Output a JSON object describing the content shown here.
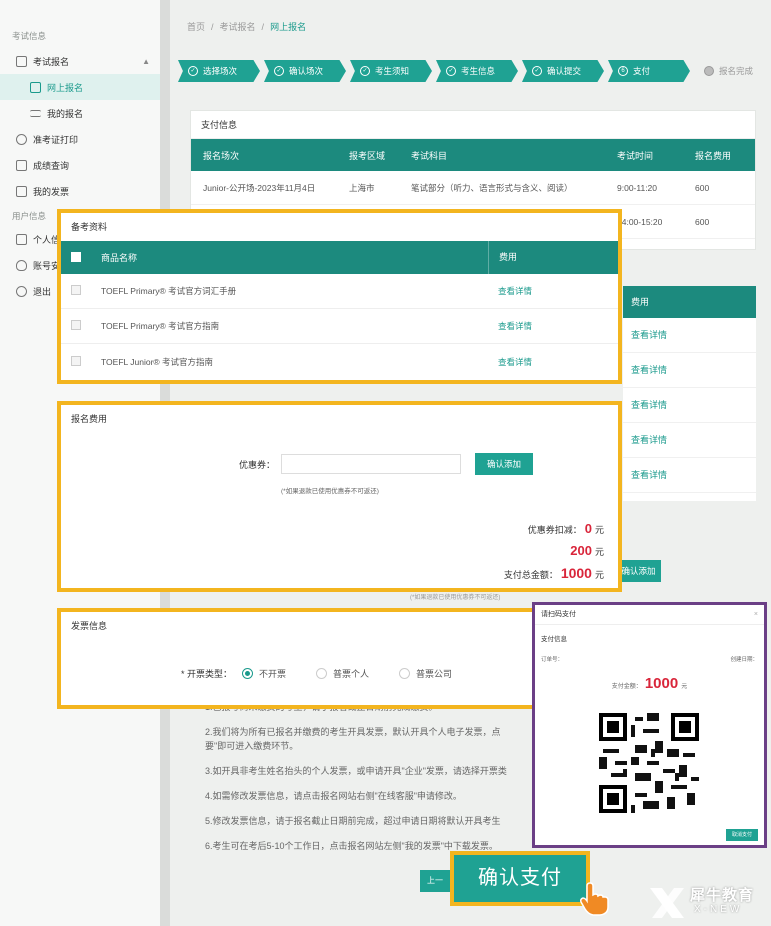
{
  "sidebar": {
    "group_exam": "考试信息",
    "items": [
      {
        "label": "考试报名"
      },
      {
        "label": "网上报名"
      },
      {
        "label": "我的报名"
      },
      {
        "label": "准考证打印"
      },
      {
        "label": "成绩查询"
      },
      {
        "label": "我的发票"
      }
    ],
    "group_user": "用户信息",
    "user_items": [
      {
        "label": "个人信"
      },
      {
        "label": "账号安"
      },
      {
        "label": "退出"
      }
    ]
  },
  "breadcrumb": [
    "首页",
    "考试报名",
    "网上报名"
  ],
  "steps": [
    "选择场次",
    "确认场次",
    "考生须知",
    "考生信息",
    "确认提交",
    "支付",
    "报名完成"
  ],
  "payment_info": {
    "title": "支付信息",
    "headers": [
      "报名场次",
      "报考区域",
      "考试科目",
      "考试时间",
      "报名费用"
    ],
    "rows": [
      [
        "Junior-公开场-2023年11月4日",
        "上海市",
        "笔试部分（听力、语言形式与含义、阅读）",
        "9:00-11:20",
        "600"
      ],
      [
        "",
        "",
        "",
        "14:00-15:20",
        "600"
      ]
    ]
  },
  "bg_fee_table": {
    "header": "费用",
    "rows": [
      "查看详情",
      "查看详情",
      "查看详情",
      "查看详情",
      "查看详情"
    ]
  },
  "bg_confirm_label": "确认添加",
  "bg_coupon_note": "(*如果退款已使用优惠券不可返还)",
  "materials": {
    "title": "备考资料",
    "headers": [
      "商品名称",
      "费用"
    ],
    "rows": [
      {
        "name": "TOEFL Primary® 考试官方词汇手册",
        "action": "查看详情"
      },
      {
        "name": "TOEFL Primary® 考试官方指南",
        "action": "查看详情"
      },
      {
        "name": "TOEFL Junior® 考试官方指南",
        "action": "查看详情"
      }
    ]
  },
  "fee": {
    "title": "报名费用",
    "coupon_label": "优惠券：",
    "coupon_value": "",
    "coupon_placeholder": "",
    "confirm_label": "确认添加",
    "note": "(*如果退款已使用优惠券不可返还)",
    "discount_label": "优惠券扣减：",
    "discount_value": "0",
    "subtotal_value": "200",
    "total_label": "支付总金额：",
    "total_value": "1000",
    "currency": "元"
  },
  "invoice": {
    "title": "发票信息",
    "type_label": "* 开票类型：",
    "options": [
      "不开票",
      "普票个人",
      "普票公司"
    ],
    "selected": "不开票"
  },
  "notice": [
    "1.已报考尚未缴费的考生，请于报名截止日期前完成缴费。",
    "2.我们将为所有已报名并缴费的考生开具发票，默认开具个人电子发票，点",
    "要\"即可进入缴费环节。",
    "3.如开具非考生姓名抬头的个人发票，或申请开具\"企业\"发票，请选择开票类",
    "4.如需修改发票信息，请点击报名网站右侧\"在线客服\"申请修改。",
    "5.修改发票信息，请于报名截止日期前完成，超过申请日期将默认开具考生",
    "6.考生可在考后5-10个工作日，点击报名网站左侧\"我的发票\"中下载发票。"
  ],
  "bg_prev_label": "上一",
  "qr_dialog": {
    "title": "请扫码支付",
    "close": "×",
    "subtitle": "支付信息",
    "order_label": "订单号：",
    "created_label": "创建日期：",
    "amount_label": "支付金额：",
    "amount_value": "1000",
    "currency": "元",
    "cancel_label": "取消支付"
  },
  "pay_button_label": "确认支付",
  "brand": {
    "cn": "犀牛教育",
    "en": "X-NEW"
  },
  "colors": {
    "primary": "#1fa293",
    "header": "#1c8a7e",
    "highlight": "#f3b51f",
    "dialog_border": "#6b3f86",
    "price": "#d9253a"
  },
  "icons": [
    "edit-icon",
    "doc-icon",
    "list-icon",
    "print-icon",
    "search-icon",
    "invoice-icon",
    "user-icon",
    "shield-icon",
    "logout-icon",
    "check-icon",
    "qr-code-icon",
    "hand-pointer-icon"
  ]
}
